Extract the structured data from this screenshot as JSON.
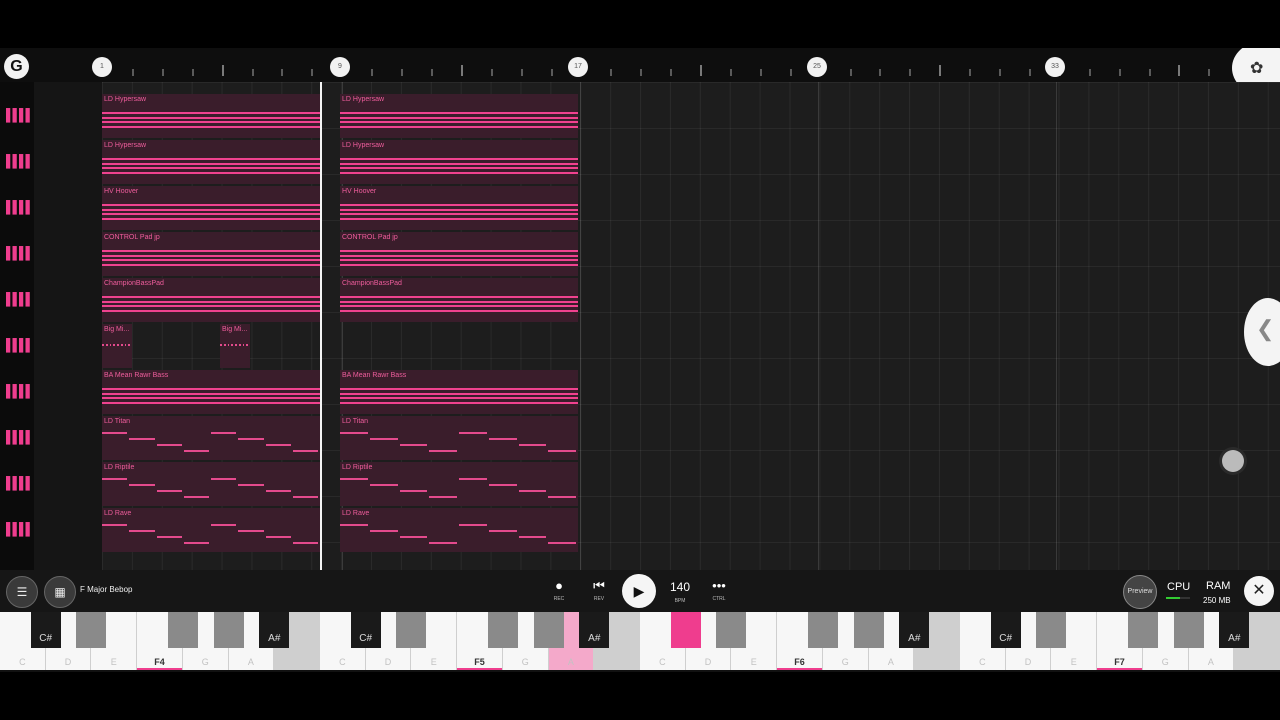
{
  "ruler": {
    "bars": [
      "1",
      "9",
      "17",
      "25",
      "33"
    ]
  },
  "logo": {
    "glyph": "G"
  },
  "tracks": [
    {
      "name": "LD Hypersaw",
      "clips": [
        "LD Hypersaw",
        "LD Hypersaw"
      ]
    },
    {
      "name": "LD Hypersaw",
      "clips": [
        "LD Hypersaw",
        "LD Hypersaw"
      ]
    },
    {
      "name": "HV Hoover",
      "clips": [
        "HV Hoover",
        "HV Hoover"
      ]
    },
    {
      "name": "CONTROL Pad jp",
      "clips": [
        "CONTROL Pad jp",
        "CONTROL Pad jp"
      ]
    },
    {
      "name": "ChampionBassPad",
      "clips": [
        "ChampionBassPad",
        "ChampionBassPad"
      ]
    },
    {
      "name": "Big Mi...",
      "clips": [
        "Big Mi...",
        "Big Mi..."
      ]
    },
    {
      "name": "BA Mean Rawr Bass",
      "clips": [
        "BA Mean Rawr Bass",
        "BA Mean Rawr Bass"
      ]
    },
    {
      "name": "LD Titan",
      "clips": [
        "LD Titan",
        "LD Titan"
      ]
    },
    {
      "name": "LD Riptile",
      "clips": [
        "LD Riptile",
        "LD Riptile"
      ]
    },
    {
      "name": "LD Rave",
      "clips": [
        "LD Rave",
        "LD Rave"
      ]
    }
  ],
  "transport": {
    "scale": "F Major Bebop",
    "rec": "REC",
    "rev": "REV",
    "bpm": "140",
    "bpm_caption": "BPM",
    "ctrl": "CTRL",
    "preview": "Preview",
    "cpu": "CPU",
    "ram": "RAM",
    "ram_value": "250 MB"
  },
  "keyboard": {
    "white_keys": [
      "C",
      "D",
      "E",
      "F4",
      "G",
      "A",
      "",
      "C",
      "D",
      "E",
      "F5",
      "G",
      "A",
      "",
      "C",
      "D",
      "E",
      "F6",
      "G",
      "A",
      "",
      "C",
      "D",
      "E",
      "F7",
      "G",
      "A",
      ""
    ],
    "black_keys": [
      "C#",
      "",
      "",
      "",
      "A#",
      "C#",
      "",
      "",
      "",
      "A#",
      "",
      "",
      "",
      "",
      "A#",
      "C#",
      "",
      "",
      "",
      "A#"
    ]
  },
  "colors": {
    "accent": "#ef3d8e",
    "clip_bg": "#3a1d2b",
    "grid_bg": "#1d1d1d"
  }
}
